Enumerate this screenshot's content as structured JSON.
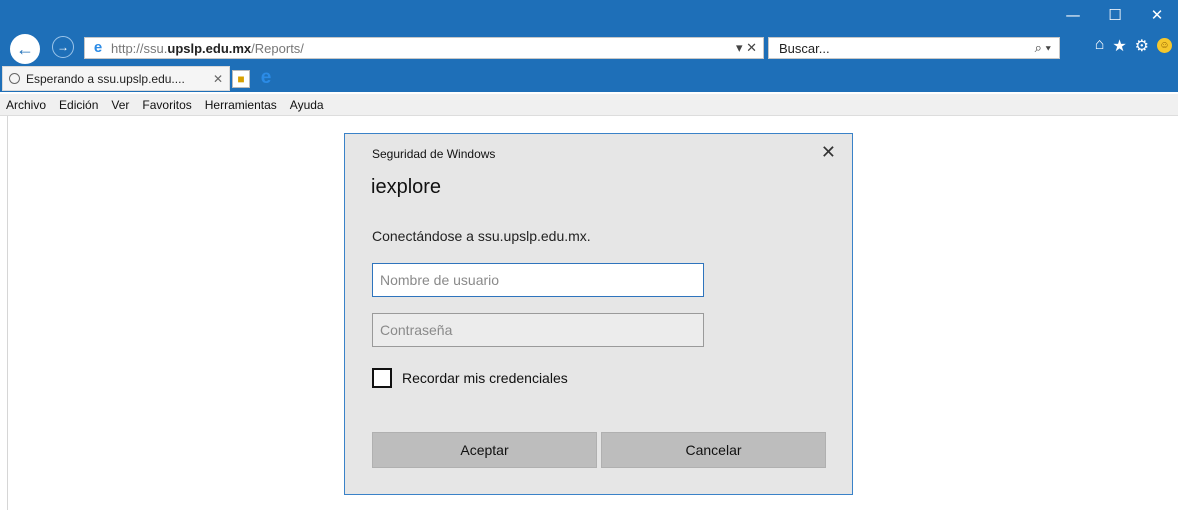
{
  "window": {
    "minimize": "—",
    "maximize": "☐",
    "close": "✕"
  },
  "nav": {
    "back_icon": "back-arrow-icon",
    "forward_icon": "forward-arrow-icon",
    "url_prefix": "http://ssu.",
    "url_domain": "upslp.edu.mx",
    "url_path": "/Reports/",
    "address_dropdown": "▾",
    "address_stop": "✕",
    "search_placeholder": "Buscar...",
    "search_icon": "⌕ ▾",
    "toolbar": {
      "home": "⌂",
      "favorites": "★",
      "settings": "⚙",
      "feedback": "☺"
    }
  },
  "tabs": [
    {
      "label": "Esperando a ssu.upslp.edu....",
      "close": "✕"
    }
  ],
  "menu": [
    "Archivo",
    "Edición",
    "Ver",
    "Favoritos",
    "Herramientas",
    "Ayuda"
  ],
  "dialog": {
    "caption": "Seguridad de Windows",
    "close": "✕",
    "app": "iexplore",
    "connect_text": "Conectándose a ssu.upslp.edu.mx.",
    "username_placeholder": "Nombre de usuario",
    "password_placeholder": "Contraseña",
    "remember_label": "Recordar mis credenciales",
    "ok_label": "Aceptar",
    "cancel_label": "Cancelar"
  },
  "colors": {
    "chrome_blue": "#1e6fb8",
    "dialog_bg": "#e6e6e6",
    "dialog_border": "#3a82c8"
  }
}
